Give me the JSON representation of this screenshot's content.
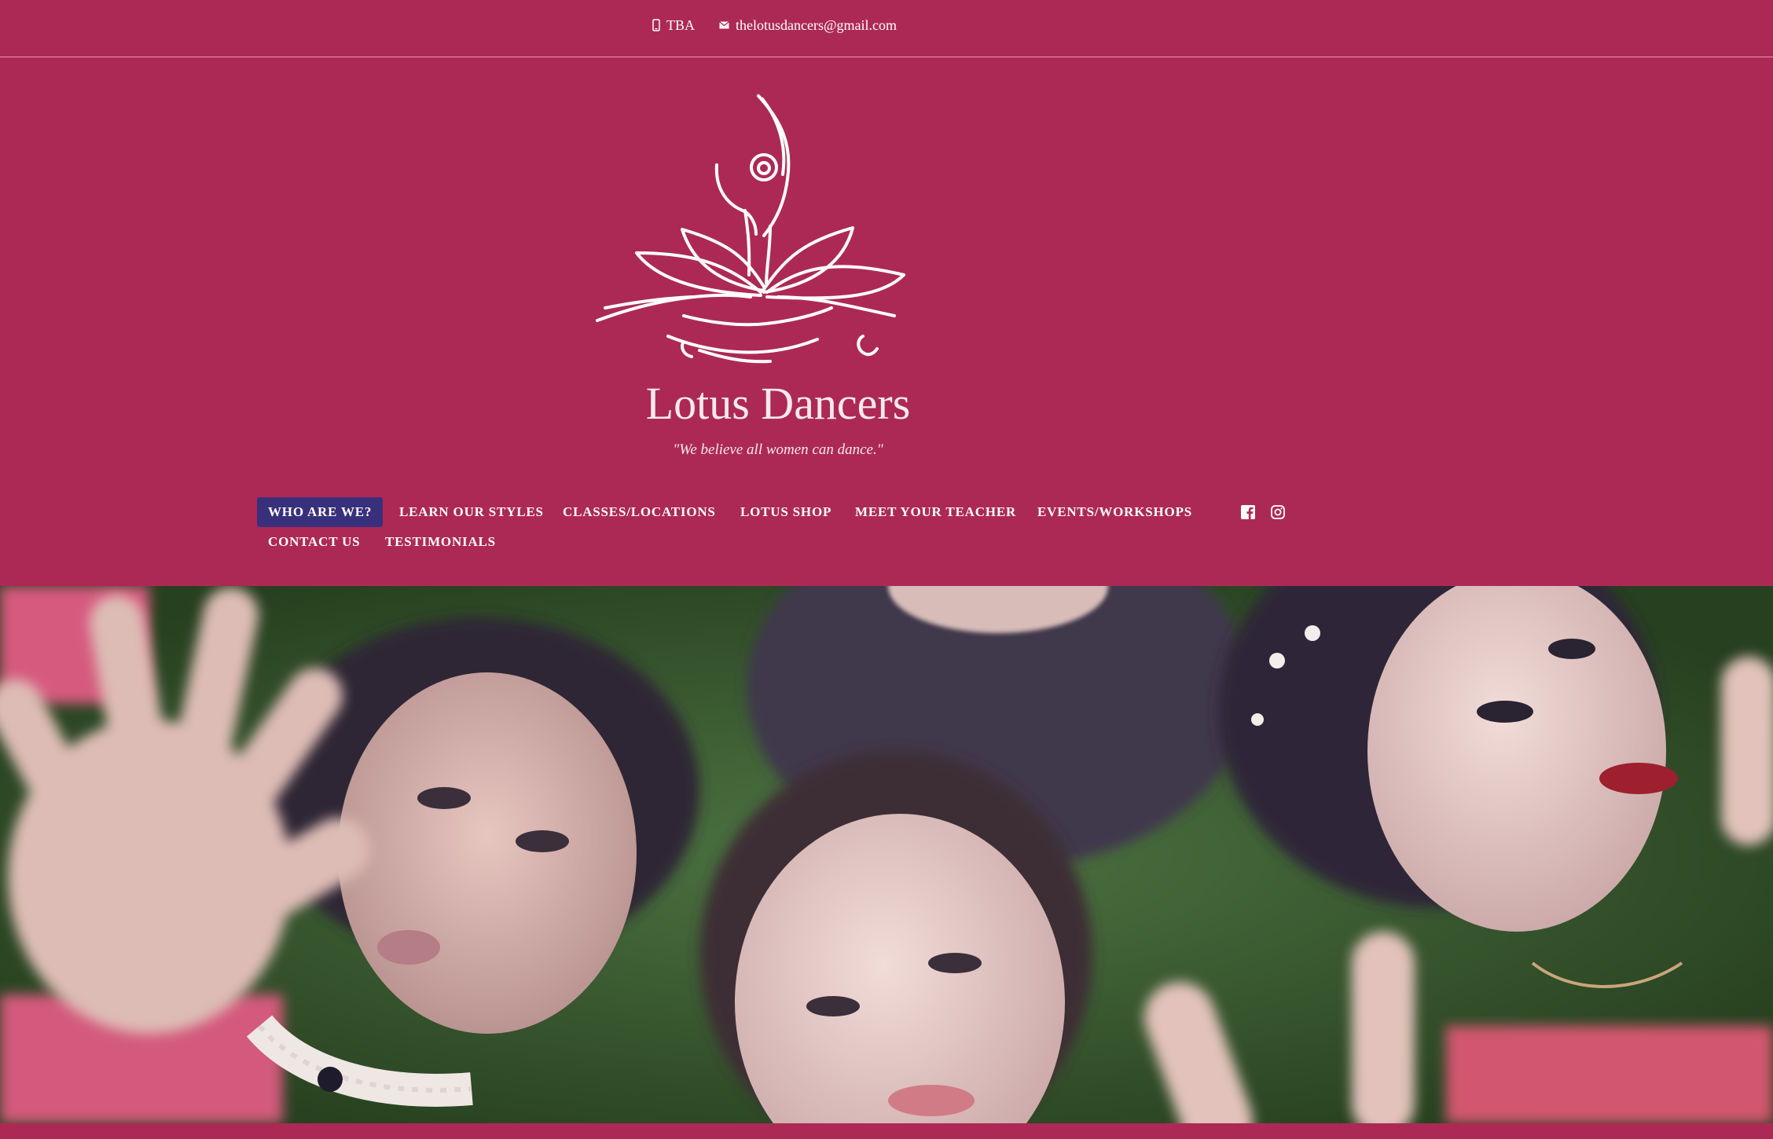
{
  "topbar": {
    "phone": {
      "icon": "phone-icon",
      "text": "TBA"
    },
    "email": {
      "icon": "mail-icon",
      "text": "thelotusdancers@gmail.com"
    }
  },
  "brand": {
    "logo": "lotus-dancer-logo",
    "title": "Lotus Dancers",
    "tagline": "\"We believe all women can dance.\""
  },
  "nav": {
    "items": [
      {
        "label": "WHO ARE WE?",
        "active": true
      },
      {
        "label": "LEARN OUR STYLES",
        "active": false
      },
      {
        "label": "CLASSES/LOCATIONS",
        "active": false
      },
      {
        "label": "LOTUS SHOP",
        "active": false
      },
      {
        "label": "MEET YOUR TEACHER",
        "active": false
      },
      {
        "label": "EVENTS/WORKSHOPS",
        "active": false
      },
      {
        "label": "CONTACT US",
        "active": false
      },
      {
        "label": "TESTIMONIALS",
        "active": false
      }
    ],
    "social": [
      "facebook-icon",
      "instagram-icon"
    ]
  },
  "hero": {
    "image": "four-dancers-lying-on-grass-photo"
  },
  "colors": {
    "page_background": "#ad2955",
    "active_nav_background": "#39307c",
    "text": "#ffffff"
  }
}
